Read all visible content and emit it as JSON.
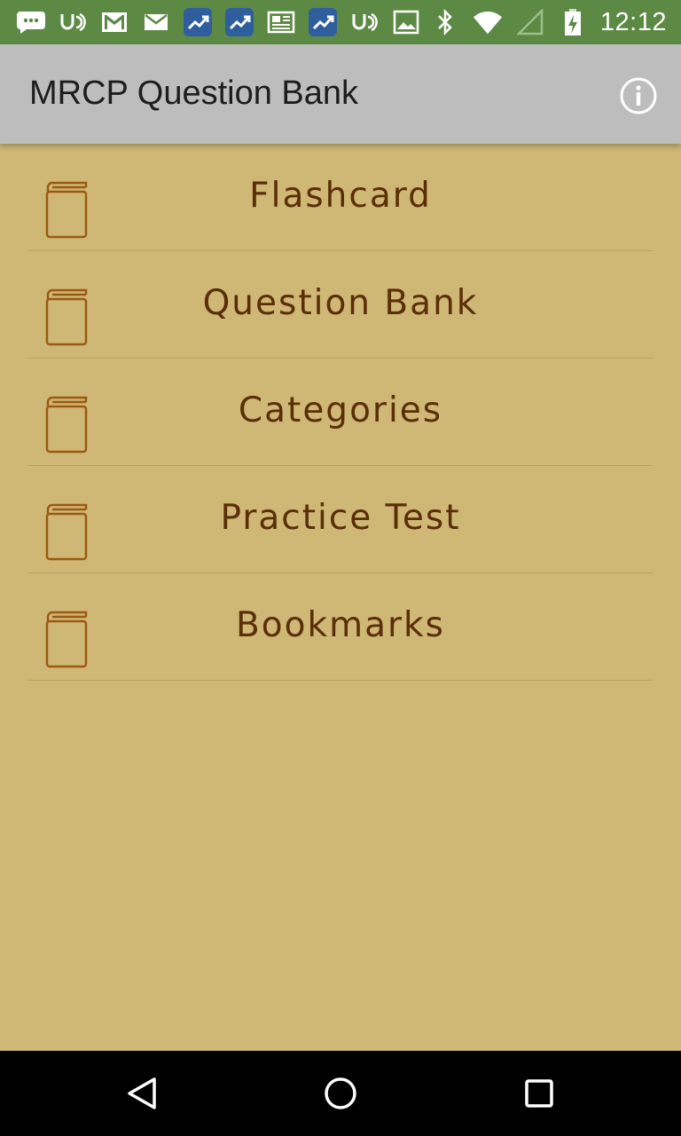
{
  "status_bar": {
    "time": "12:12",
    "left_icons": [
      "message-bubble-icon",
      "hearing-icon",
      "gmail-icon",
      "mail-icon",
      "stocks-app-icon",
      "stocks-app-icon",
      "news-icon",
      "stocks-app-icon",
      "hearing-icon",
      "photo-icon"
    ],
    "right_icons": [
      "bluetooth-icon",
      "wifi-icon",
      "signal-icon",
      "battery-charging-icon"
    ]
  },
  "app_bar": {
    "title": "MRCP Question Bank",
    "info_icon": "info-icon"
  },
  "menu": {
    "items": [
      {
        "label": "Flashcard",
        "icon": "book-icon"
      },
      {
        "label": "Question Bank",
        "icon": "book-icon"
      },
      {
        "label": "Categories",
        "icon": "book-icon"
      },
      {
        "label": "Practice Test",
        "icon": "book-icon"
      },
      {
        "label": "Bookmarks",
        "icon": "book-icon"
      }
    ]
  },
  "nav_bar": {
    "back_icon": "back-triangle-icon",
    "home_icon": "home-circle-icon",
    "recents_icon": "recents-square-icon"
  },
  "colors": {
    "status_bar": "#5c8a45",
    "app_bar": "#bdbdbd",
    "background": "#cfb775",
    "menu_text": "#5a2e07",
    "icon_stroke": "#9a5a12"
  }
}
